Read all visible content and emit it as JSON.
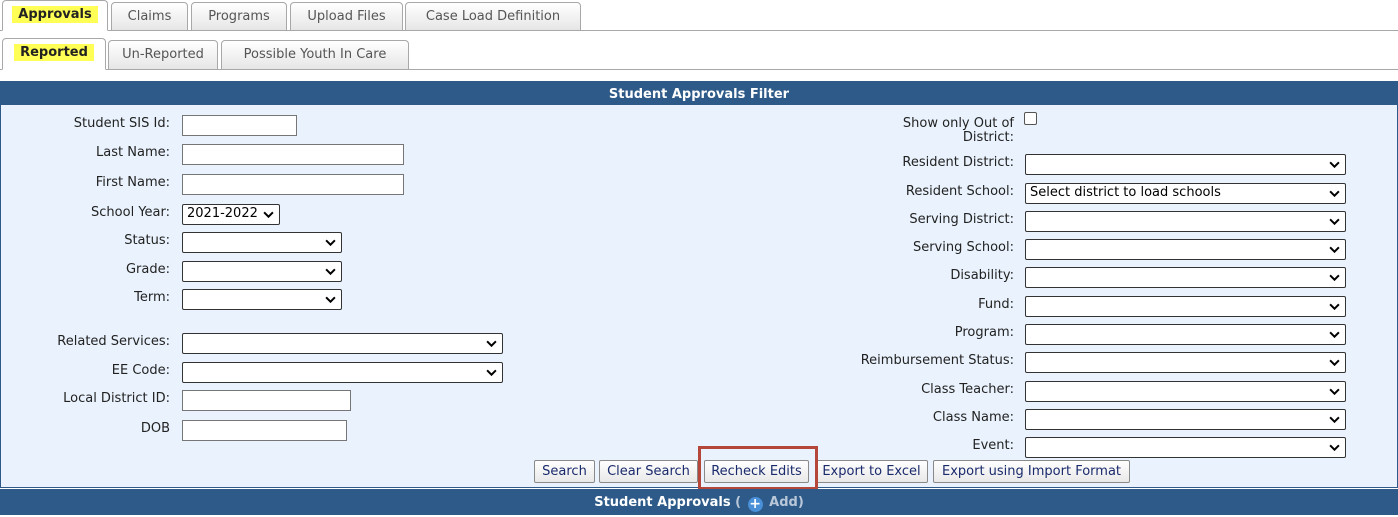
{
  "tabs_primary": [
    "Approvals",
    "Claims",
    "Programs",
    "Upload Files",
    "Case Load Definition"
  ],
  "tabs_secondary": [
    "Reported",
    "Un-Reported",
    "Possible Youth In Care"
  ],
  "panel": {
    "title": "Student Approvals Filter",
    "left": {
      "student_sis_id": "Student SIS Id:",
      "last_name": "Last Name:",
      "first_name": "First Name:",
      "school_year": "School Year:",
      "school_year_value": "2021-2022",
      "status": "Status:",
      "grade": "Grade:",
      "term": "Term:",
      "related_services": "Related Services:",
      "ee_code": "EE Code:",
      "local_district_id": "Local District ID:",
      "dob": "DOB"
    },
    "right": {
      "out_of_district_line1": "Show only Out of",
      "out_of_district_line2": "District:",
      "resident_district": "Resident District:",
      "resident_school": "Resident School:",
      "resident_school_value": "Select district to load schools",
      "serving_district": "Serving District:",
      "serving_school": "Serving School:",
      "disability": "Disability:",
      "fund": "Fund:",
      "program": "Program:",
      "reimbursement_status": "Reimbursement Status:",
      "class_teacher": "Class Teacher:",
      "class_name": "Class Name:",
      "event": "Event:"
    }
  },
  "buttons": {
    "search": "Search",
    "clear_search": "Clear Search",
    "recheck_edits": "Recheck Edits",
    "export_excel": "Export to Excel",
    "export_import": "Export using Import Format"
  },
  "footer": {
    "title": "Student Approvals",
    "open_paren": "(",
    "add": "Add)"
  },
  "colors": {
    "header_blue": "#2d5a88",
    "panel_bg": "#eaf3fd",
    "highlight": "#ffff55",
    "annotation_box": "#b5473a"
  }
}
